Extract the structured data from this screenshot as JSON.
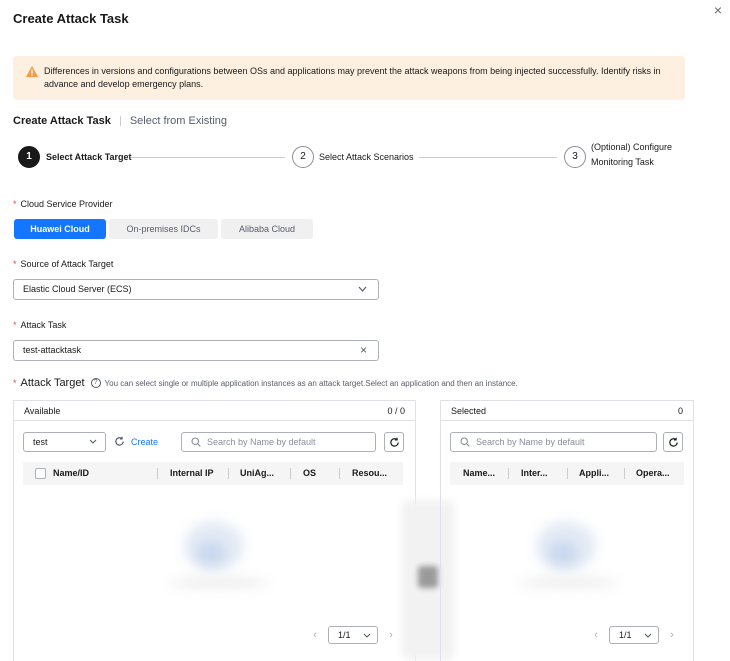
{
  "dialog": {
    "title": "Create Attack Task",
    "close_glyph": "×"
  },
  "alert": {
    "icon": "warning-icon",
    "color": "#fdf0e0",
    "text": "Differences in versions and configurations between OSs and applications may prevent the attack weapons from being injected successfully. Identify risks in advance and develop emergency plans."
  },
  "mode_tabs": {
    "active": "Create Attack Task",
    "inactive": "Select from Existing"
  },
  "steps": [
    {
      "num": "1",
      "label": "Select Attack Target"
    },
    {
      "num": "2",
      "label": "Select Attack Scenarios"
    },
    {
      "num": "3",
      "label_line1": "(Optional) Configure",
      "label_line2": "Monitoring Task"
    }
  ],
  "provider": {
    "label": "Cloud Service Provider",
    "options": [
      "Huawei Cloud",
      "On-premises IDCs",
      "Alibaba Cloud"
    ],
    "selected": "Huawei Cloud",
    "accent": "#1476ff"
  },
  "source": {
    "label": "Source of Attack Target",
    "value": "Elastic Cloud Server (ECS)"
  },
  "attack_task": {
    "label": "Attack Task",
    "value": "test-attacktask"
  },
  "attack_target": {
    "label": "Attack Target",
    "hint": "You can select single or multiple application instances as an attack target.Select an application and then an instance."
  },
  "available": {
    "title": "Available",
    "count": "0 / 0",
    "app_select": "test",
    "create_label": "Create",
    "search_placeholder": "Search by Name by default",
    "columns": [
      "Name/ID",
      "Internal IP",
      "UniAg...",
      "OS",
      "Resou..."
    ],
    "pager": {
      "page": "1/1"
    }
  },
  "selected": {
    "title": "Selected",
    "count": "0",
    "search_placeholder": "Search by Name by default",
    "columns": [
      "Name...",
      "Inter...",
      "Appli...",
      "Opera..."
    ],
    "pager": {
      "page": "1/1"
    }
  },
  "required_mark": "*"
}
